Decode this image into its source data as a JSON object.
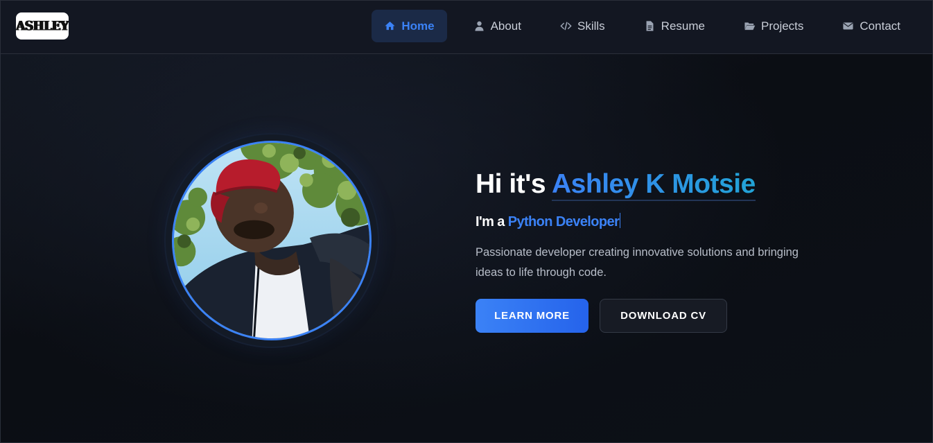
{
  "brand": {
    "logo_text": "ASHLEY"
  },
  "nav": {
    "items": [
      {
        "label": "Home",
        "icon": "home-icon",
        "active": true
      },
      {
        "label": "About",
        "icon": "user-icon",
        "active": false
      },
      {
        "label": "Skills",
        "icon": "code-icon",
        "active": false
      },
      {
        "label": "Resume",
        "icon": "file-icon",
        "active": false
      },
      {
        "label": "Projects",
        "icon": "folder-open-icon",
        "active": false
      },
      {
        "label": "Contact",
        "icon": "envelope-icon",
        "active": false
      }
    ]
  },
  "hero": {
    "greeting": "Hi it's ",
    "name": "Ashley K Motsie",
    "sub_prefix": "I'm a ",
    "role": "Python Developer",
    "description": "Passionate developer creating innovative solutions and bringing ideas to life through code.",
    "primary_button": "LEARN MORE",
    "secondary_button": "DOWNLOAD CV"
  },
  "colors": {
    "accent": "#3b82f6",
    "background": "#0b0e14",
    "header": "#131722"
  }
}
